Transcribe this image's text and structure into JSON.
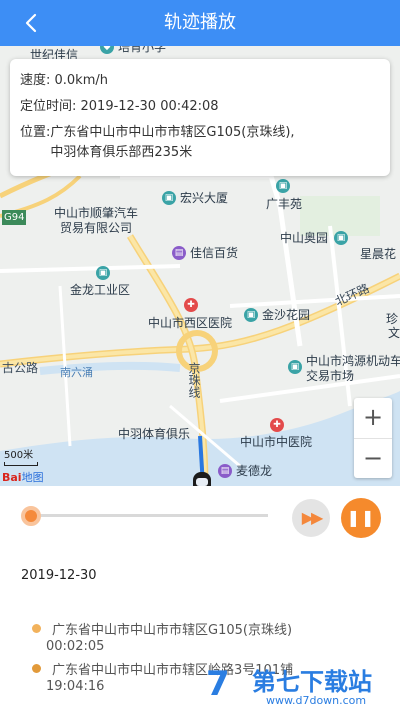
{
  "header": {
    "title": "轨迹播放",
    "back_icon": "chevron-left-icon"
  },
  "info": {
    "speed": "速度: 0.0km/h",
    "locate_time": "定位时间: 2019-12-30 00:42:08",
    "address_label": "位置:",
    "address_line1": "广东省中山市中山市市辖区G105(京珠线),",
    "address_line2": "中羽体育俱乐部西235米"
  },
  "map": {
    "pois": {
      "hongxing": "宏兴大厦",
      "guangfengyuan": "广丰苑",
      "shunzhao_1": "中山市顺肇汽车",
      "shunzhao_2": "贸易有限公司",
      "aoyuan": "中山奥园",
      "xingchen": "星晨花",
      "jiaxin": "佳信百货",
      "jinlong": "金龙工业区",
      "xiqu_hospital": "中山市西区医院",
      "jinsha": "金沙花园",
      "zhen": "珍",
      "wen": "文",
      "hongyuan_1": "中山市鸿源机动车",
      "hongyuan_2": "交易市场",
      "zhongyu": "中羽体育俱乐",
      "zhongyiyuan": "中山市中医院",
      "maidelong": "麦德龙",
      "shijia": "世纪佳信",
      "peiyu": "培育小学",
      "g94": "G94"
    },
    "roads": {
      "beihuan": "北环路",
      "gugong": "古公路",
      "nanliuchong": "南六涌",
      "jingzhu": "京珠线"
    },
    "scale": "500米",
    "logo_main": "Bai",
    "logo_sub": "地图",
    "zoom_in": "+",
    "zoom_out": "−"
  },
  "player": {
    "progress": 0.0,
    "fast_forward_icon": "fast-forward-icon",
    "pause_icon": "pause-icon",
    "ff_glyph": "▶▶",
    "pause_glyph": "❚❚",
    "accent": "#f58a2c"
  },
  "date": "2019-12-30",
  "records": [
    {
      "address": "广东省中山市中山市市辖区G105(京珠线)",
      "time": "00:02:05"
    },
    {
      "address": "广东省中山市中山市市辖区岭路3号101铺",
      "time": "19:04:16"
    }
  ],
  "watermark": {
    "mark": "7",
    "text": "第七下载站",
    "url": "www.d7down.com"
  },
  "colors": {
    "header_bg": "#3d8ef5",
    "accent": "#f58a2c"
  }
}
